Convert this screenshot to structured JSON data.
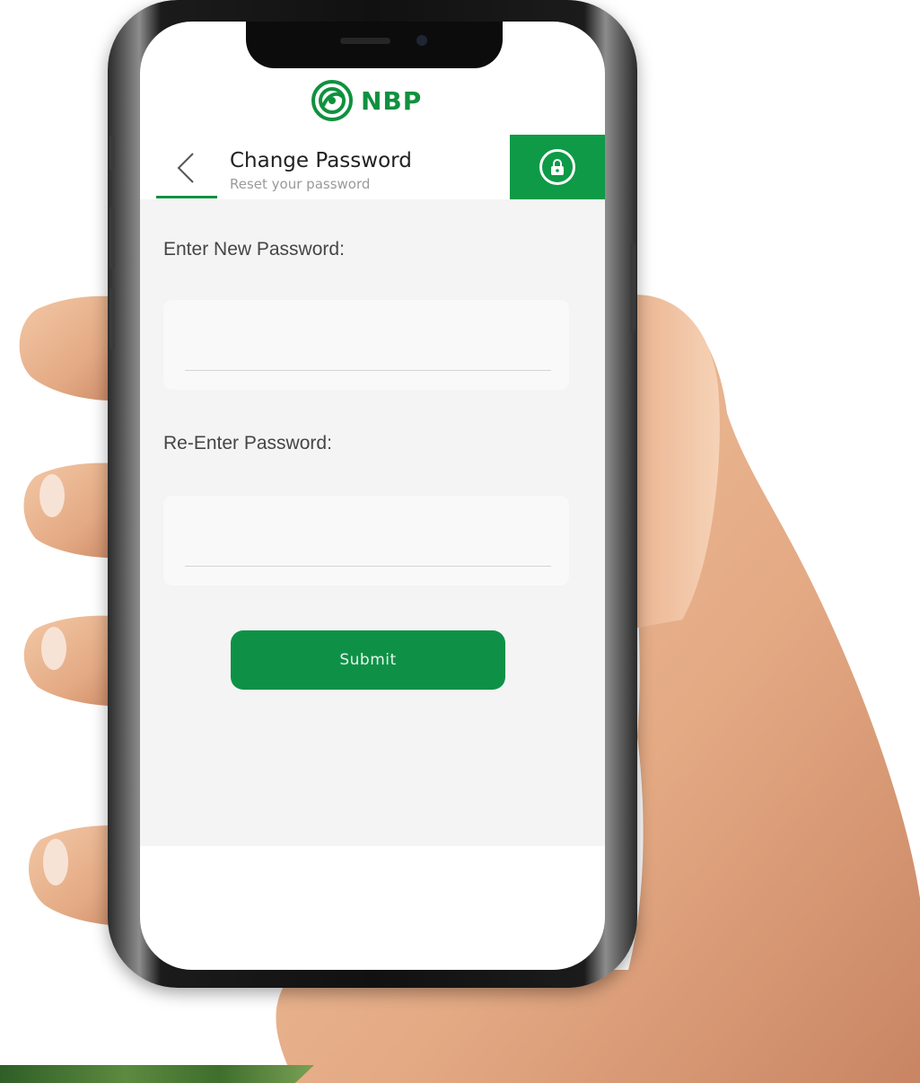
{
  "brand": {
    "name": "NBP",
    "color": "#10913f",
    "logo_icon": "nbp-logo-icon"
  },
  "header": {
    "back_icon": "chevron-left-icon",
    "title": "Change Password",
    "subtitle": "Reset your password",
    "lock_icon": "lock-icon",
    "accent": "#0e9a46"
  },
  "form": {
    "new_password_label": "Enter New Password:",
    "new_password_value": "",
    "reenter_password_label": "Re-Enter Password:",
    "reenter_password_value": "",
    "submit_label": "Submit"
  }
}
